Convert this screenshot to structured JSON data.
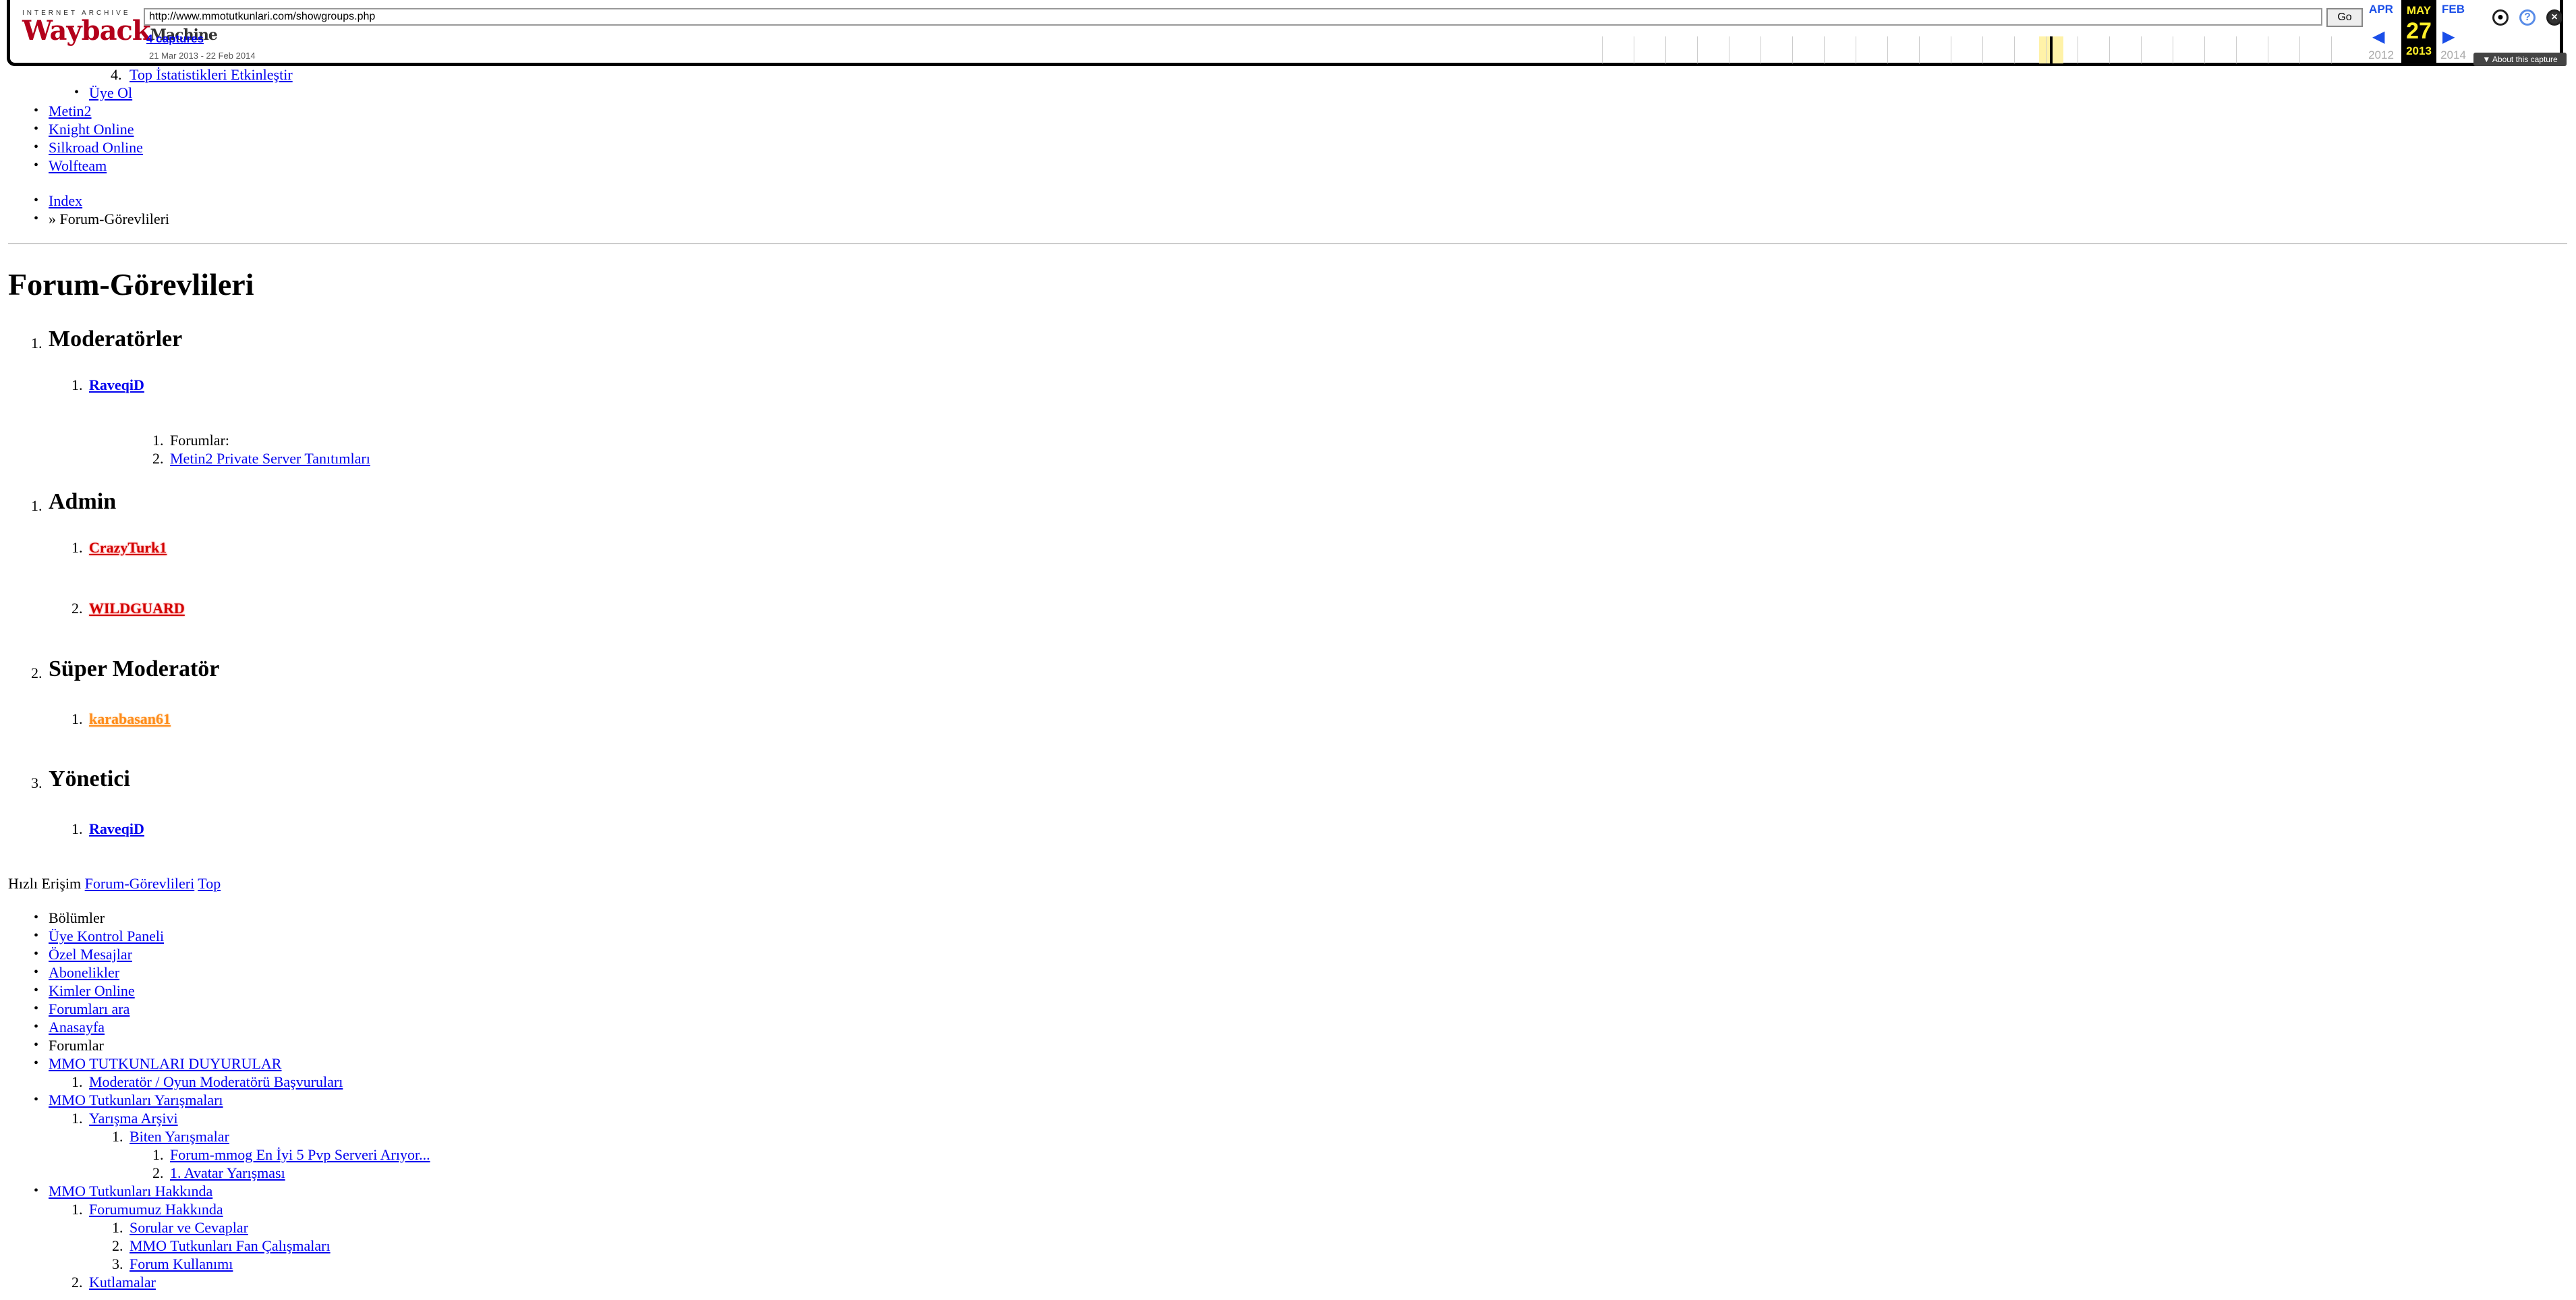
{
  "wayback": {
    "logo_top": "INTERNET ARCHIVE",
    "logo_main_1": "Wayback",
    "logo_main_2": "Machine",
    "url": "http://www.mmotutkunlari.com/showgroups.php",
    "go_label": "Go",
    "captures_label": "4 captures",
    "capture_range": "21 Mar 2013 - 22 Feb 2014",
    "prev_month": "APR",
    "current_month": "MAY",
    "current_day": "27",
    "current_year": "2013",
    "next_month": "FEB",
    "prev_year": "2012",
    "next_year": "2014",
    "about_label": "▼ About this capture"
  },
  "top_nav": {
    "sub_link_partial": "Top İstatistikleri Etkinleştir",
    "register": "Üye Ol",
    "games": [
      "Metin2",
      "Knight Online",
      "Silkroad Online",
      "Wolfteam"
    ]
  },
  "breadcrumb": {
    "index": "Index",
    "current": "» Forum-Görevlileri"
  },
  "page_title": "Forum-Görevlileri",
  "groups": {
    "moderators": {
      "title": "Moderatörler",
      "num": "1.",
      "users": [
        "RaveqiD"
      ],
      "forums_label": "Forumlar:",
      "forums": [
        "Metin2 Private Server Tanıtımları"
      ]
    },
    "admin": {
      "title": "Admin",
      "num": "1.",
      "users": [
        "CrazyTurk1",
        "WILDGUARD"
      ]
    },
    "super_moderator": {
      "title": "Süper Moderatör",
      "num": "2.",
      "users": [
        "karabasan61"
      ]
    },
    "manager": {
      "title": "Yönetici",
      "num": "3.",
      "users": [
        "RaveqiD"
      ]
    }
  },
  "quick_access": {
    "label": "Hızlı Erişim",
    "link1": "Forum-Görevlileri",
    "link2": "Top"
  },
  "footer_nav": {
    "sections": "Bölümler",
    "items": [
      "Üye Kontrol Paneli",
      "Özel Mesajlar",
      "Abonelikler",
      "Kimler Online",
      "Forumları ara",
      "Anasayfa"
    ],
    "forums": "Forumlar",
    "mmo_announcements": "MMO TUTKUNLARI DUYURULAR",
    "mod_applications": "Moderatör / Oyun Moderatörü Başvuruları",
    "competitions": "MMO Tutkunları Yarışmaları",
    "competition_archive": "Yarışma Arşivi",
    "finished": "Biten Yarışmalar",
    "finished_items": [
      "Forum-mmog En İyi 5 Pvp Serveri Arıyor...",
      "1. Avatar Yarışması"
    ],
    "about": "MMO Tutkunları Hakkında",
    "about_forum": "Forumumuz Hakkında",
    "about_forum_items": [
      "Sorular ve Cevaplar",
      "MMO Tutkunları Fan Çalışmaları",
      "Forum Kullanımı"
    ],
    "congrats": "Kutlamalar"
  }
}
